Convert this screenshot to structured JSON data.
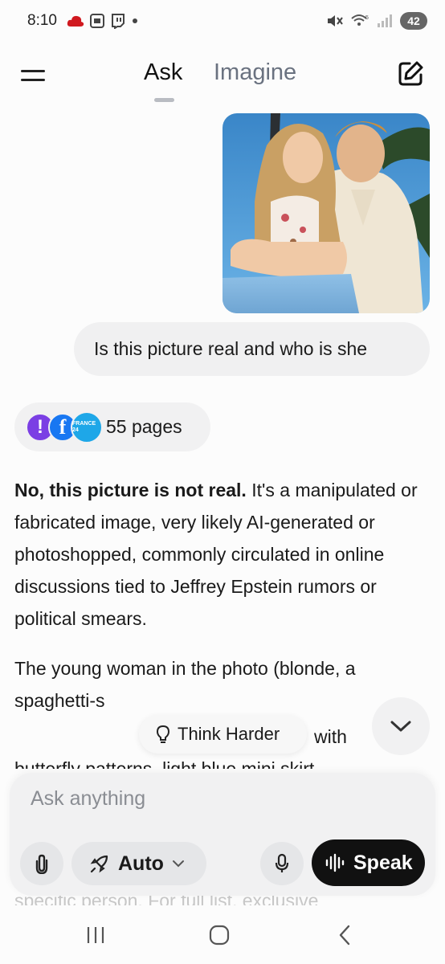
{
  "status_bar": {
    "time": "8:10",
    "battery": "42",
    "left_icons": [
      "cloud-icon",
      "screenshot-icon",
      "twitch-icon",
      "dot-icon"
    ],
    "right_icons": [
      "mute-icon",
      "wifi-icon",
      "signal-icon"
    ]
  },
  "header": {
    "tabs": [
      {
        "label": "Ask",
        "active": true
      },
      {
        "label": "Imagine",
        "active": false
      }
    ]
  },
  "chat": {
    "user_message": "Is this picture real and who is she",
    "sources": {
      "label": "55 pages",
      "icon_badge": "FRANCE 24"
    },
    "answer": {
      "bold_lead": "No, this picture is not real.",
      "para1_rest": " It's a manipulated or fabricated image, very likely AI-generated or photoshopped, commonly circulated in online discussions tied to Jeffrey Epstein rumors or political smears.",
      "para2": "The young woman in the photo (blonde, a spaghetti-s",
      "para2_line2_end": "with",
      "para2_line3": "butterfly patterns, light blue mini skirt"
    },
    "partial_bottom_text": "specific person. For full list, exclusive"
  },
  "think_harder": {
    "label": "Think Harder"
  },
  "composer": {
    "placeholder": "Ask anything",
    "mode": "Auto",
    "speak_label": "Speak"
  }
}
